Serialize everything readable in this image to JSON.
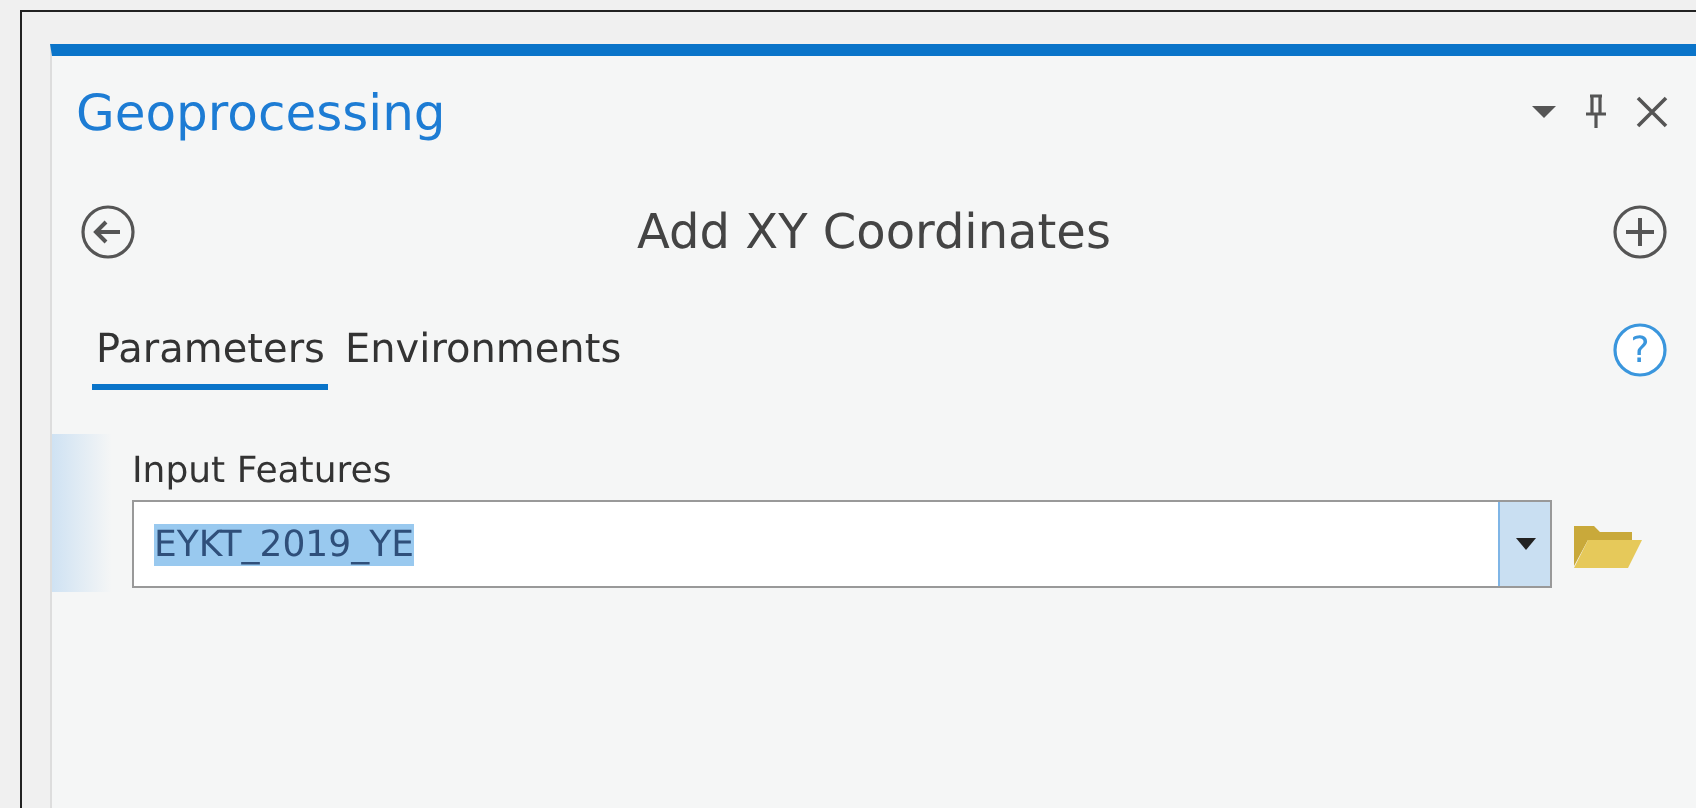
{
  "pane": {
    "title": "Geoprocessing"
  },
  "tool": {
    "title": "Add XY Coordinates"
  },
  "tabs": [
    {
      "label": "Parameters",
      "selected": true
    },
    {
      "label": "Environments",
      "selected": false
    }
  ],
  "help": {
    "label": "?"
  },
  "parameters": [
    {
      "label": "Input Features",
      "value": "EYKT_2019_YE",
      "value_selected": true
    }
  ]
}
